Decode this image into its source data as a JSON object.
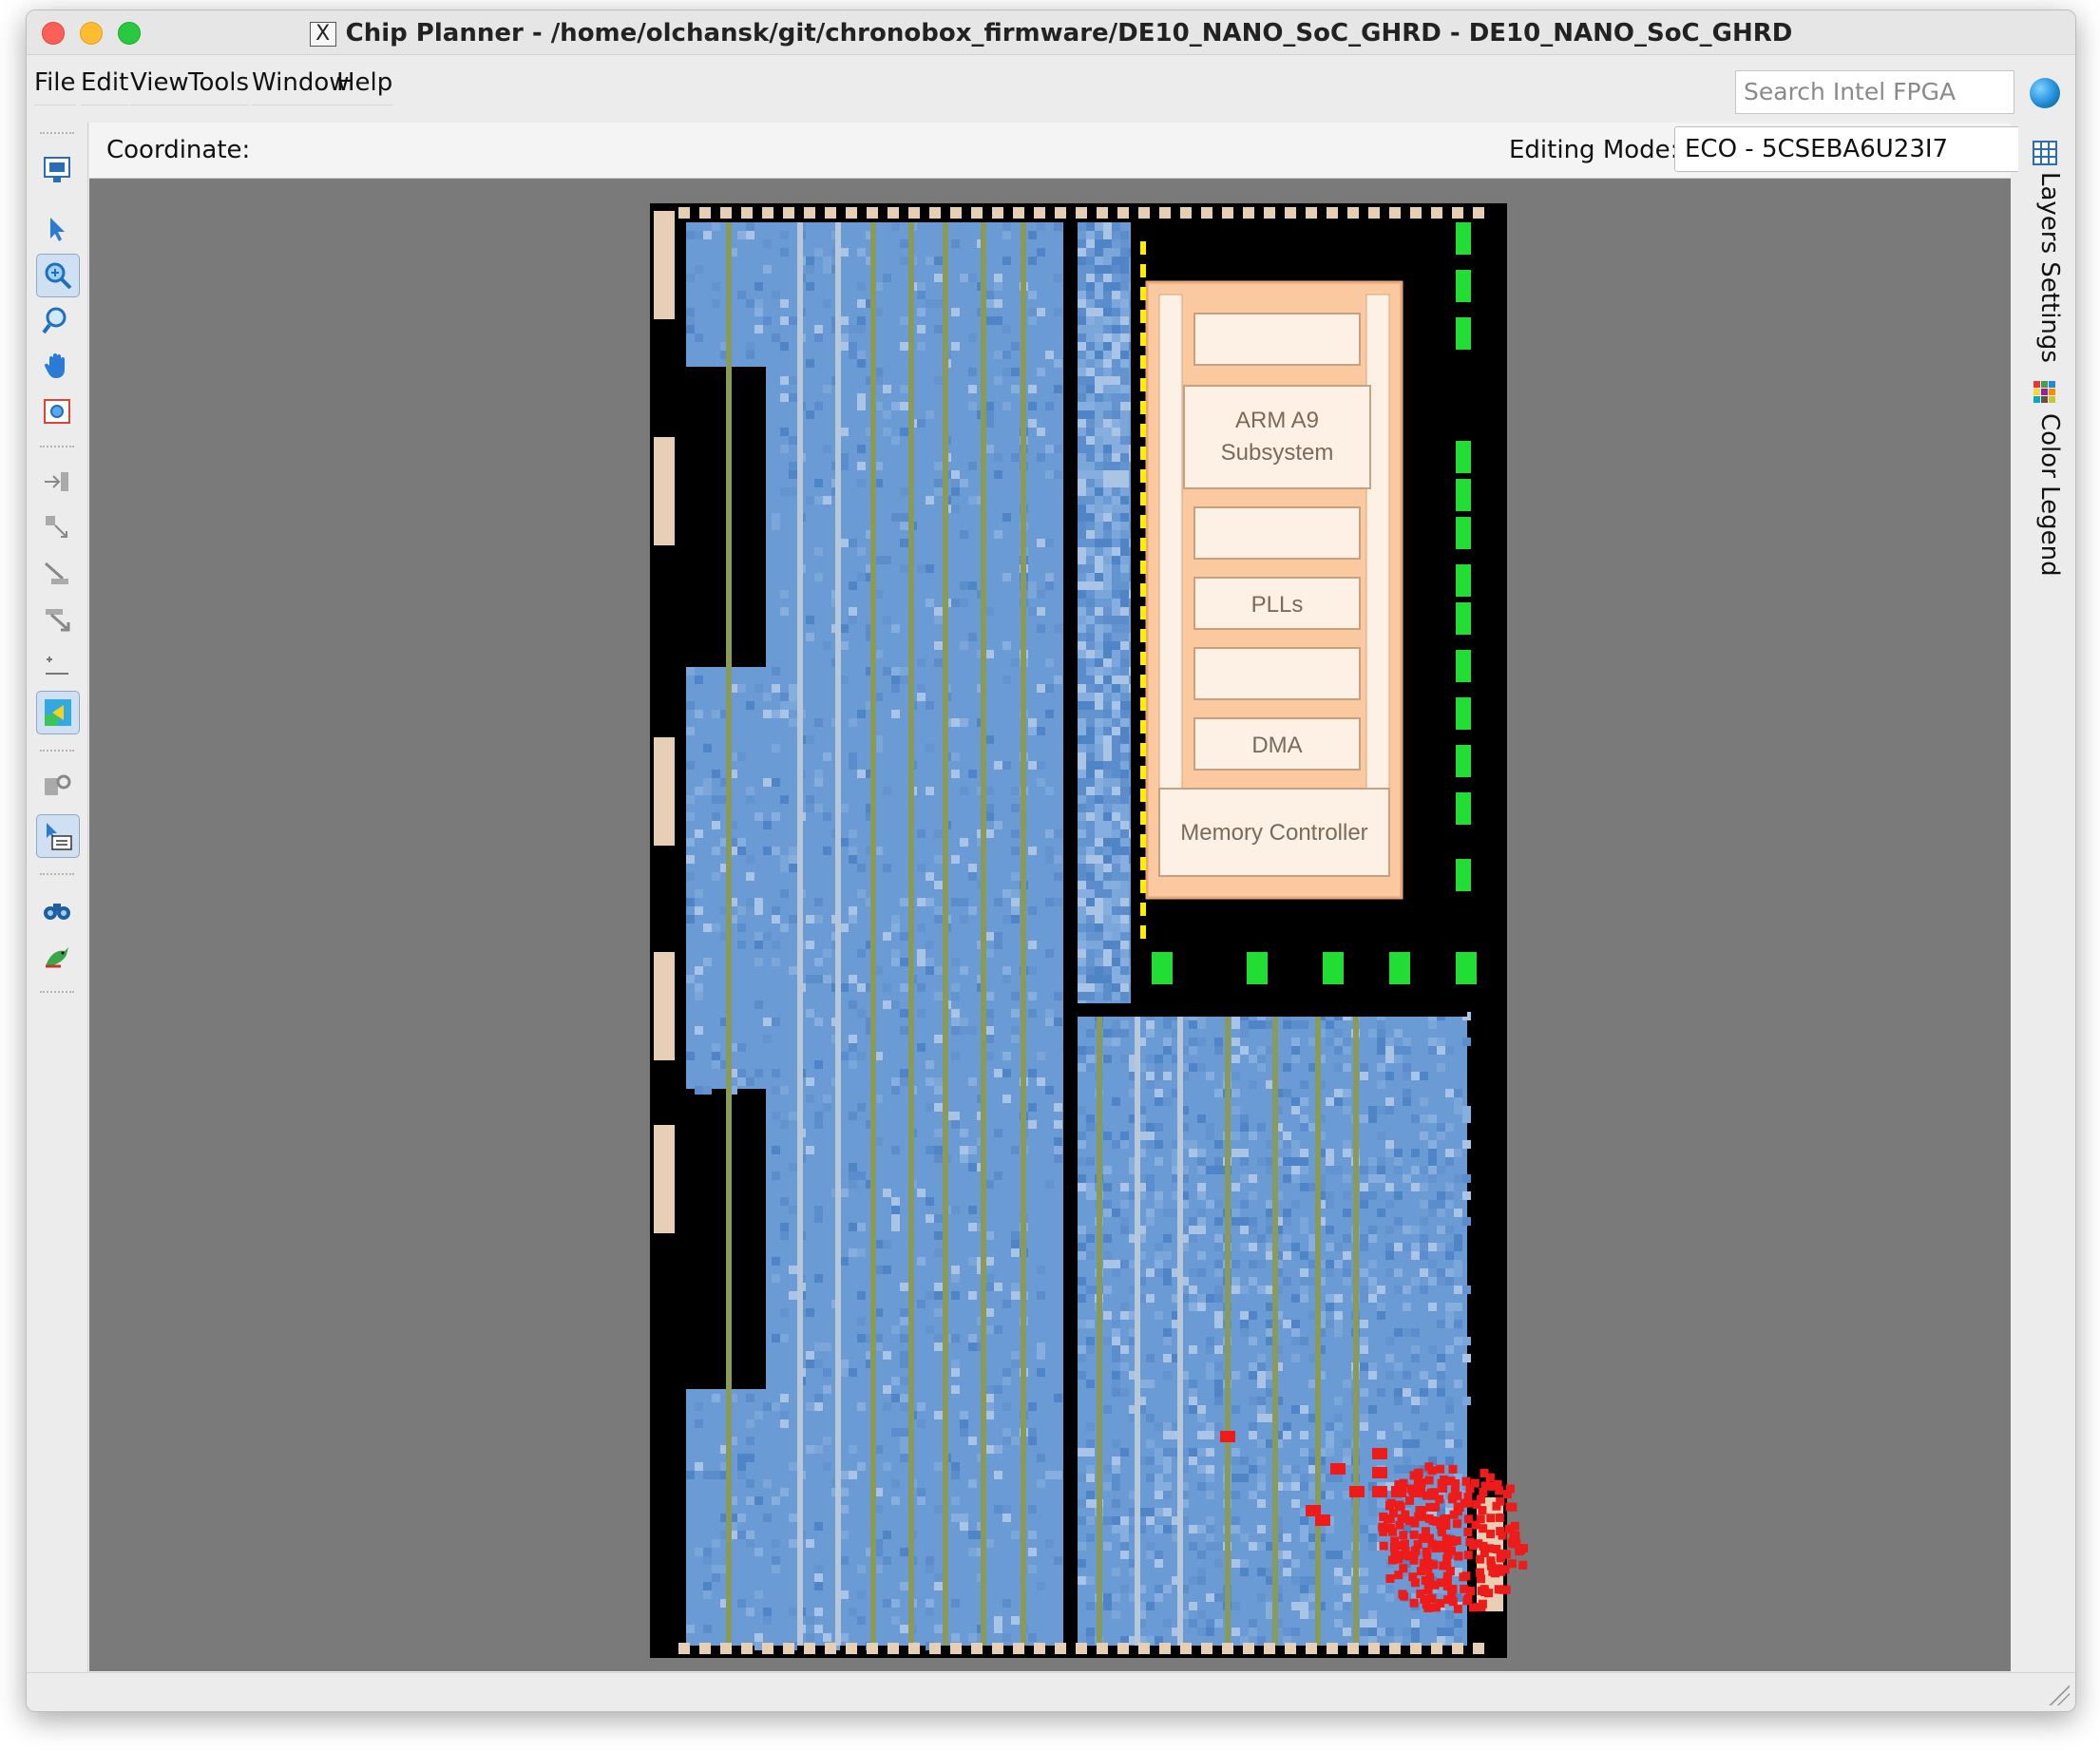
{
  "window": {
    "title": "Chip Planner - /home/olchansk/git/chronobox_firmware/DE10_NANO_SoC_GHRD - DE10_NANO_SoC_GHRD"
  },
  "menu": [
    "File",
    "Edit",
    "View",
    "Tools",
    "Window",
    "Help"
  ],
  "search": {
    "placeholder": "Search Intel FPGA"
  },
  "toolbar": {
    "coordinate_label": "Coordinate:",
    "editing_mode_label": "Editing Mode:",
    "editing_mode_value": "ECO - 5CSEBA6U23I7"
  },
  "side_tabs": {
    "layers": "Layers Settings",
    "legend": "Color Legend"
  },
  "hps": {
    "arm": "ARM A9\nSubsystem",
    "plls": "PLLs",
    "dma": "DMA",
    "memory": "Memory Controller"
  },
  "colors": {
    "canvas": "#7a7a7a",
    "fabric": "#6a9bd4",
    "fabric_light": "#a9c4e4",
    "dsp_column": "#8a9a5b",
    "io_bank": "#e6cfb4",
    "hps_fill": "#fbc9a0",
    "hps_box": "#fdf1e6",
    "placed_logic": "#ee1b1b",
    "io_pin": "#22dd33",
    "clock_pin": "#ffee00"
  },
  "icons": [
    "chip-planner-icon",
    "select-icon",
    "zoom-in-icon",
    "zoom-region-icon",
    "hand-icon",
    "fit-window-icon",
    "fan-in-icon",
    "fan-out-icon",
    "immediate-fan-in-icon",
    "immediate-fan-out-icon",
    "distance-icon",
    "color-map-icon",
    "locate-icon",
    "properties-icon",
    "binoculars-icon",
    "bird-icon"
  ]
}
